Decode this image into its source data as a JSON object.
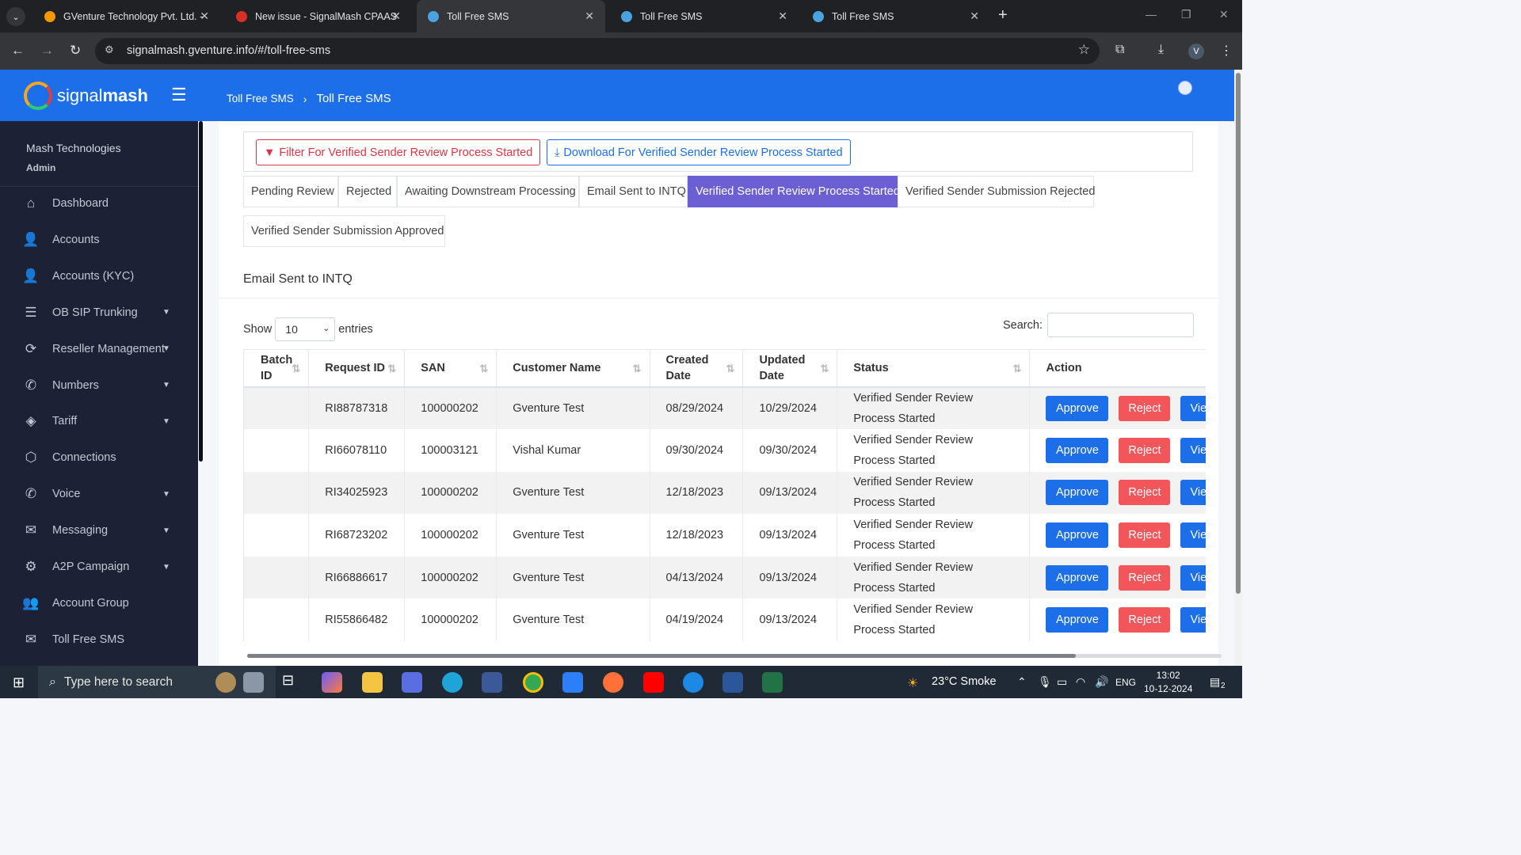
{
  "browser": {
    "tabs": [
      {
        "title": "GVenture Technology Pvt. Ltd. -",
        "color": "#f29900"
      },
      {
        "title": "New issue - SignalMash CPAAS",
        "color": "#d93025"
      },
      {
        "title": "Toll Free SMS",
        "color": "#4aa3df"
      },
      {
        "title": "Toll Free SMS",
        "color": "#4aa3df"
      },
      {
        "title": "Toll Free SMS",
        "color": "#4aa3df"
      }
    ],
    "url": "signalmash.gventure.info/#/toll-free-sms",
    "profile": "V"
  },
  "header": {
    "logo_light": "signal",
    "logo_bold": "mash",
    "breadcrumb": [
      "Toll Free SMS",
      "Toll Free SMS"
    ]
  },
  "sidebar": {
    "user": "Mash Technologies",
    "role": "Admin",
    "items": [
      {
        "label": "Dashboard",
        "icon": "home-icon",
        "glyph": "⌂",
        "caret": false
      },
      {
        "label": "Accounts",
        "icon": "user-icon",
        "glyph": "👤",
        "caret": false
      },
      {
        "label": "Accounts (KYC)",
        "icon": "user-plus-icon",
        "glyph": "👤",
        "caret": false
      },
      {
        "label": "OB SIP Trunking",
        "icon": "database-icon",
        "glyph": "☰",
        "caret": true
      },
      {
        "label": "Reseller Management",
        "icon": "sync-icon",
        "glyph": "⟳",
        "caret": true
      },
      {
        "label": "Numbers",
        "icon": "phone-forward-icon",
        "glyph": "✆",
        "caret": true
      },
      {
        "label": "Tariff",
        "icon": "tag-icon",
        "glyph": "◈",
        "caret": true
      },
      {
        "label": "Connections",
        "icon": "network-icon",
        "glyph": "⬡",
        "caret": false
      },
      {
        "label": "Voice",
        "icon": "phone-icon",
        "glyph": "✆",
        "caret": true
      },
      {
        "label": "Messaging",
        "icon": "envelope-icon",
        "glyph": "✉",
        "caret": true
      },
      {
        "label": "A2P Campaign",
        "icon": "gear-icon",
        "glyph": "⚙",
        "caret": true
      },
      {
        "label": "Account Group",
        "icon": "users-icon",
        "glyph": "👥",
        "caret": false
      },
      {
        "label": "Toll Free SMS",
        "icon": "sms-icon",
        "glyph": "✉",
        "caret": false
      }
    ]
  },
  "actions": {
    "filter_label": "Filter For Verified Sender Review Process Started",
    "download_label": "Download For Verified Sender Review Process Started"
  },
  "status_tabs": [
    "Pending Review",
    "Rejected",
    "Awaiting Downstream Processing",
    "Email Sent to INTQ",
    "Verified Sender Review Process Started",
    "Verified Sender Submission Rejected",
    "Verified Sender Submission Approved"
  ],
  "active_tab": "Verified Sender Review Process Started",
  "section_title": "Email Sent to INTQ",
  "table_controls": {
    "show_label": "Show",
    "entries_value": "10",
    "entries_label": "entries",
    "search_label": "Search:"
  },
  "table": {
    "columns": [
      "Batch ID",
      "Request ID",
      "SAN",
      "Customer Name",
      "Created Date",
      "Updated Date",
      "Status",
      "Action"
    ],
    "rows": [
      {
        "batch": "",
        "request": "RI88787318",
        "san": "100000202",
        "customer": "Gventure Test",
        "created": "08/29/2024",
        "updated": "10/29/2024",
        "status": "Verified Sender Review Process Started"
      },
      {
        "batch": "",
        "request": "RI66078110",
        "san": "100003121",
        "customer": "Vishal Kumar",
        "created": "09/30/2024",
        "updated": "09/30/2024",
        "status": "Verified Sender Review Process Started"
      },
      {
        "batch": "",
        "request": "RI34025923",
        "san": "100000202",
        "customer": "Gventure Test",
        "created": "12/18/2023",
        "updated": "09/13/2024",
        "status": "Verified Sender Review Process Started"
      },
      {
        "batch": "",
        "request": "RI68723202",
        "san": "100000202",
        "customer": "Gventure Test",
        "created": "12/18/2023",
        "updated": "09/13/2024",
        "status": "Verified Sender Review Process Started"
      },
      {
        "batch": "",
        "request": "RI66886617",
        "san": "100000202",
        "customer": "Gventure Test",
        "created": "04/13/2024",
        "updated": "09/13/2024",
        "status": "Verified Sender Review Process Started"
      },
      {
        "batch": "",
        "request": "RI55866482",
        "san": "100000202",
        "customer": "Gventure Test",
        "created": "04/19/2024",
        "updated": "09/13/2024",
        "status": "Verified Sender Review Process Started"
      }
    ],
    "approve_label": "Approve",
    "reject_label": "Reject",
    "view_label": "View"
  },
  "taskbar": {
    "search_placeholder": "Type here to search",
    "weather": "23°C  Smoke",
    "lang": "ENG",
    "time": "13:02",
    "date": "10-12-2024",
    "notifications": "2"
  },
  "colors": {
    "brand_blue": "#1c6fe8",
    "active_tab": "#6c5fd3",
    "danger": "#dc3545",
    "sidebar_bg": "#1d2135"
  }
}
